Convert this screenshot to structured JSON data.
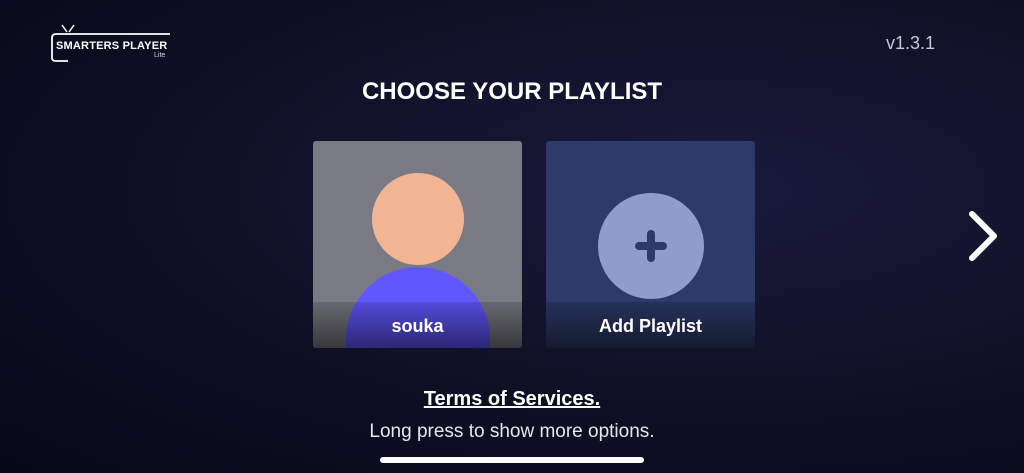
{
  "app": {
    "logo_text": "SMARTERS PLAYER",
    "logo_sub": "Lite",
    "version": "v1.3.1"
  },
  "page": {
    "title": "CHOOSE YOUR PLAYLIST"
  },
  "playlists": [
    {
      "label": "souka",
      "icon": "user-avatar-icon"
    },
    {
      "label": "Add Playlist",
      "icon": "plus-circle-icon"
    }
  ],
  "footer": {
    "terms_link": "Terms of Services.",
    "hint": "Long press to show more options."
  },
  "colors": {
    "background": "#0f0f24",
    "user_card": "#7a7a84",
    "add_card": "#2d3a6a",
    "avatar_head": "#f1b594",
    "avatar_body": "#6157ff",
    "add_circle": "#8f9ccc"
  }
}
